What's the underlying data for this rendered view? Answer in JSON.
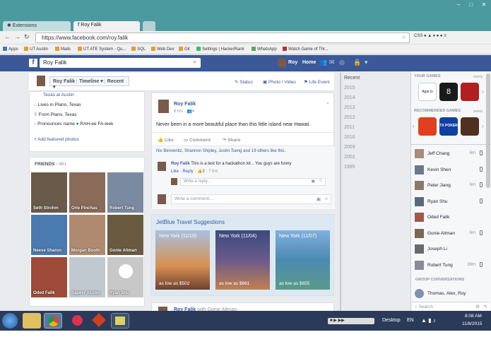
{
  "browser": {
    "tabs": [
      {
        "label": "Extensions"
      },
      {
        "label": "Roy Falik"
      }
    ],
    "url": "https://www.facebook.com/roy.falik",
    "bookmarks": [
      "Apps",
      "UT Austin",
      "Mails",
      "UT ATE System - Qu...",
      "SQL",
      "Web Dev",
      "Git",
      "Settings | HackerRank",
      "WhatsApp",
      "Watch Game of Thr..."
    ]
  },
  "fb_header": {
    "logo": "f",
    "search_value": "Roy Falik",
    "profile_name": "Roy",
    "home_label": "Home"
  },
  "timeline_nav": {
    "name": "Roy Falik",
    "timeline": "Timeline",
    "recent": "Recent",
    "status": "Status",
    "photo_video": "Photo / Video",
    "life_event": "Life Event"
  },
  "about": {
    "school": "Texas at Austin",
    "lives": "Lives in Plano, Texas",
    "from": "From Plano, Texas",
    "pronounce_label": "Pronounces name",
    "pronounce_value": "RAH-ee FA-leek",
    "add_photos": "Add featured photos"
  },
  "friends": {
    "title": "FRIENDS",
    "count": "881",
    "items": [
      {
        "name": "Seth Strohm",
        "color": "#6a5a4a"
      },
      {
        "name": "Orie Pinchas",
        "color": "#8a6a58"
      },
      {
        "name": "Robert Tung",
        "color": "#7a8aa0"
      },
      {
        "name": "Neeve Sharon",
        "color": "#4a7ab0"
      },
      {
        "name": "Morgan Booth",
        "color": "#b08a70"
      },
      {
        "name": "Gonie Altman",
        "color": "#6a5a40"
      },
      {
        "name": "Oded Falik",
        "color": "#a04a3a"
      },
      {
        "name": "Sapeer Azulay",
        "color": "#c0c8d0"
      },
      {
        "name": "Ryan Shu",
        "color": "#c8c8c8"
      }
    ]
  },
  "post": {
    "author": "Roy Falik",
    "time": "8 hrs",
    "text": "Never been in a more beautiful place than this little island near Hawaii.",
    "like": "Like",
    "comment": "Comment",
    "share": "Share",
    "likes_line": "Niv Benvenitz, Shannon Shipley, Justin Tseng and 19 others like this.",
    "comment_author": "Roy Falik",
    "comment_text": "This is a test for a hackathon lol... You guys are funny",
    "comment_actions": "Like · Reply ·",
    "comment_likes": "2",
    "comment_time": "· 7 hrs",
    "reply_placeholder": "Write a reply...",
    "comment_placeholder": "Write a comment..."
  },
  "travel": {
    "title": "JetBlue Travel Suggestions",
    "items": [
      {
        "dest": "New York (11/18)",
        "price": "as low as $502"
      },
      {
        "dest": "New York (11/04)",
        "price": "as low as $661"
      },
      {
        "dest": "New York (11/07)",
        "price": "as low as $655"
      }
    ]
  },
  "next_post": {
    "author": "Roy Falik",
    "with": "with Gonie Altman"
  },
  "years": [
    "Recent",
    "2015",
    "2014",
    "2013",
    "2012",
    "2011",
    "2010",
    "2009",
    "2002",
    "1995"
  ],
  "right": {
    "your_games": "YOUR GAMES",
    "more": "MORE",
    "recommended": "RECOMMENDED GAMES",
    "game_badges": [
      "Agar.io",
      "",
      "",
      "",
      "TX POKER",
      ""
    ],
    "chat": [
      {
        "name": "Jeff Chang",
        "time": "6m"
      },
      {
        "name": "Kevin Shen",
        "time": ""
      },
      {
        "name": "Peter Jiang",
        "time": "6m"
      },
      {
        "name": "Ryan Shu",
        "time": ""
      },
      {
        "name": "Oded Falik",
        "time": ""
      },
      {
        "name": "Gonie Altman",
        "time": "6m"
      },
      {
        "name": "Joseph Li",
        "time": ""
      },
      {
        "name": "Robert Tung",
        "time": "39m"
      }
    ],
    "group_title": "GROUP CONVERSATIONS",
    "group_names": "Thomas, Alex, Roy",
    "search_placeholder": "Search"
  },
  "taskbar": {
    "desktop": "Desktop",
    "lang": "EN",
    "time": "8:08 AM",
    "date": "11/8/2015"
  }
}
